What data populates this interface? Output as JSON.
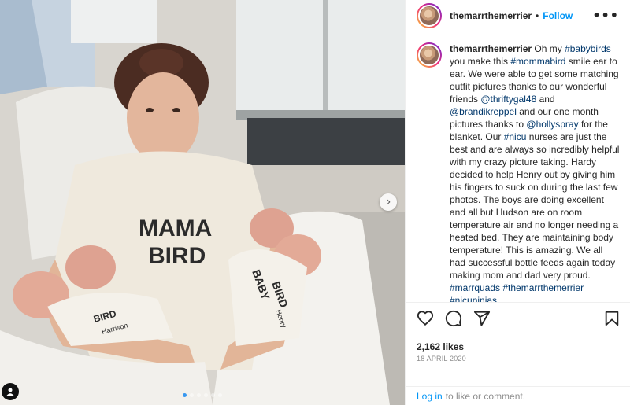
{
  "post": {
    "username": "themarrthemerrier",
    "separator": "•",
    "follow_label": "Follow",
    "more_icon": "more-options-icon",
    "more_glyph": "•••"
  },
  "caption": {
    "username": "themarrthemerrier",
    "segments": [
      {
        "t": " Oh my ",
        "k": "text"
      },
      {
        "t": "#babybirds",
        "k": "link"
      },
      {
        "t": " you make this ",
        "k": "text"
      },
      {
        "t": "#mommabird",
        "k": "link"
      },
      {
        "t": " smile ear to ear. We were able to get some matching outfit pictures thanks to our wonderful friends ",
        "k": "text"
      },
      {
        "t": "@thriftygal48",
        "k": "link"
      },
      {
        "t": " and ",
        "k": "text"
      },
      {
        "t": "@brandikreppel",
        "k": "link"
      },
      {
        "t": " and our one month pictures thanks to ",
        "k": "text"
      },
      {
        "t": "@hollyspray",
        "k": "link"
      },
      {
        "t": " for the blanket. Our ",
        "k": "text"
      },
      {
        "t": "#nicu",
        "k": "link"
      },
      {
        "t": " nurses are just the best and are always so incredibly helpful with my crazy picture taking. Hardy decided to help Henry out by giving him his fingers to suck on during the last few photos. The boys are doing excellent and all but Hudson are on room temperature air and no longer needing a heated bed. They are maintaining body temperature! This is amazing. We all had successful bottle feeds again today making mom and dad very proud. ",
        "k": "text"
      },
      {
        "t": "#marrquads",
        "k": "link"
      },
      {
        "t": " ",
        "k": "text"
      },
      {
        "t": "#themarrthemerrier",
        "k": "link"
      },
      {
        "t": " ",
        "k": "text"
      },
      {
        "t": "#nicuninjas",
        "k": "link"
      }
    ]
  },
  "photo": {
    "shirt_text_line1": "MAMA",
    "shirt_text_line2": "BIRD",
    "baby_shirt_text1": "BABY",
    "baby_shirt_text2": "BIRD",
    "baby_shirt_text3": "Henry",
    "baby_shirt_text4": "BIRD",
    "baby_shirt_text5": "Harrison",
    "carousel": {
      "count": 6,
      "active_index": 0
    },
    "next_icon": "chevron-right-icon",
    "next_glyph": "›",
    "user_tag_icon": "person-tag-icon"
  },
  "actions": {
    "like_icon": "heart-icon",
    "comment_icon": "comment-icon",
    "share_icon": "share-icon",
    "save_icon": "bookmark-icon"
  },
  "likes": "2,162 likes",
  "date": "18 APRIL 2020",
  "footer": {
    "login_link": "Log in",
    "login_rest": "to like or comment."
  },
  "colors": {
    "accent": "#0095f6",
    "link": "#00376b",
    "muted": "#8e8e8e",
    "active_dot": "#3797f0"
  }
}
